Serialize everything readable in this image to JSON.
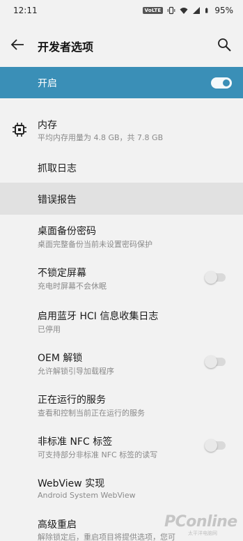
{
  "status_bar": {
    "time": "12:11",
    "network_badge": "VoLTE",
    "battery": "95%",
    "icons": [
      "vibrate-icon",
      "wifi-icon",
      "signal-icon",
      "battery-icon"
    ]
  },
  "app_bar": {
    "title": "开发者选项",
    "back_icon": "arrow-left-icon",
    "search_icon": "search-icon"
  },
  "master_switch": {
    "label": "开启",
    "enabled": true,
    "accent_color": "#3a8fb7"
  },
  "settings": [
    {
      "title": "内存",
      "subtitle": "平均内存用量为 4.8 GB，共 7.8 GB",
      "icon": "memory-chip-icon"
    },
    {
      "title": "抓取日志"
    },
    {
      "title": "错误报告",
      "highlighted": true
    },
    {
      "title": "桌面备份密码",
      "subtitle": "桌面完整备份当前未设置密码保护"
    },
    {
      "title": "不锁定屏幕",
      "subtitle": "充电时屏幕不会休眠",
      "toggle": false
    },
    {
      "title": "启用蓝牙 HCI 信息收集日志",
      "subtitle": "已停用"
    },
    {
      "title": "OEM 解锁",
      "subtitle": "允许解锁引导加载程序",
      "toggle": false
    },
    {
      "title": "正在运行的服务",
      "subtitle": "查看和控制当前正在运行的服务"
    },
    {
      "title": "非标准 NFC 标签",
      "subtitle": "可支持部分非标准 NFC 标签的读写",
      "toggle": false
    },
    {
      "title": "WebView 实现",
      "subtitle": "Android System WebView"
    },
    {
      "title": "高级重启",
      "subtitle": "解除锁定后，重启项目将提供选项，您可"
    }
  ],
  "watermark": {
    "brand": "PConline",
    "tagline": "太平洋电脑网"
  }
}
